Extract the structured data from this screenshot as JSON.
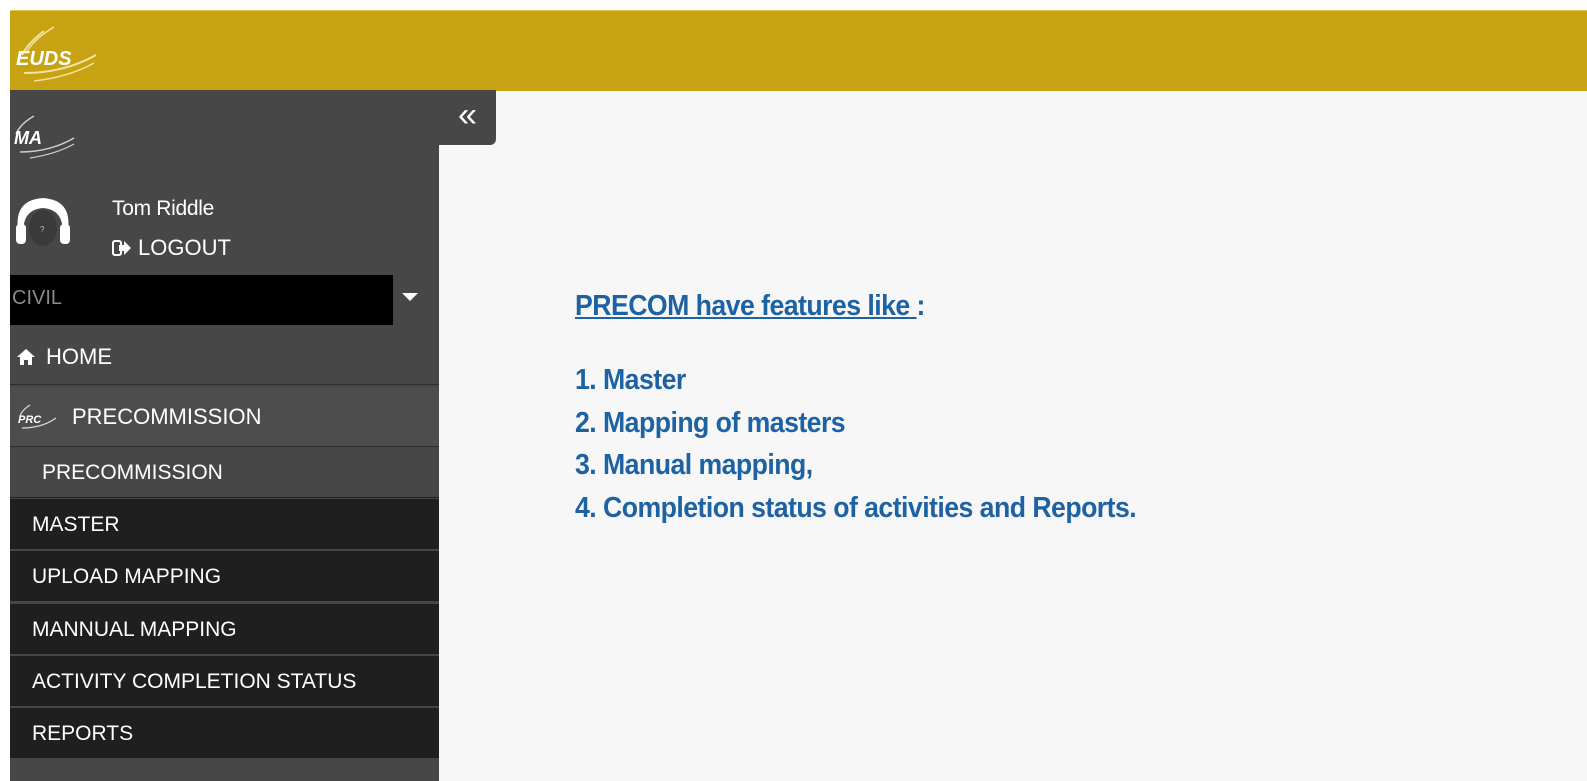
{
  "header": {
    "logo_text": "EUDS",
    "brand_color": "#c7a313"
  },
  "sidebar": {
    "module_logo_text": "MA",
    "user": {
      "name": "Tom Riddle",
      "logout_label": "LOGOUT"
    },
    "discipline_select": {
      "selected": "CIVIL"
    },
    "nav": {
      "home": "HOME",
      "precommission": "PRECOMMISSION",
      "precommission_logo_text": "PRC",
      "precommission_sub": "PRECOMMISSION",
      "sub_items": [
        "MASTER",
        "UPLOAD MAPPING",
        "MANNUAL MAPPING",
        "ACTIVITY COMPLETION STATUS",
        "REPORTS"
      ]
    },
    "collapse_icon": "double-chevron-left-icon"
  },
  "main": {
    "title_underlined": "PRECOM have features like ",
    "title_suffix": ":",
    "features": [
      "1. Master",
      "2. Mapping of masters",
      "3. Manual mapping,",
      "4. Completion status of activities and Reports."
    ],
    "text_color": "#1d62a3"
  }
}
